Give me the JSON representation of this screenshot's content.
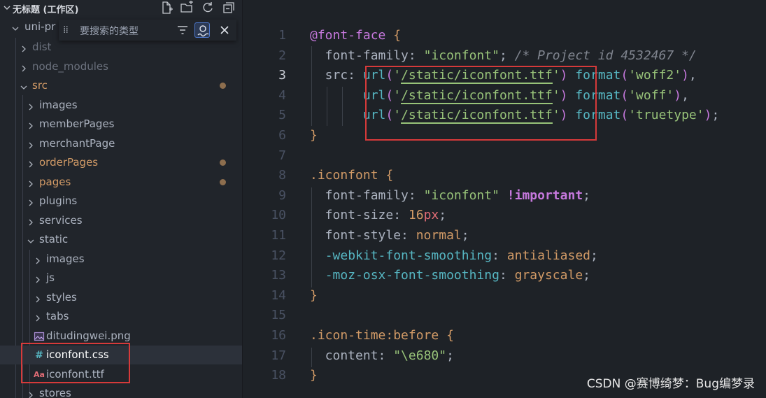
{
  "explorer": {
    "workspace_title": "无标题 (工作区)",
    "root_folder": "uni-pr",
    "search_placeholder": "要搜索的类型",
    "items": [
      {
        "label": "dist",
        "kind": "folder",
        "state": "ignored"
      },
      {
        "label": "node_modules",
        "kind": "folder",
        "state": "ignored"
      },
      {
        "label": "src",
        "kind": "folder",
        "state": "modified"
      },
      {
        "label": "images",
        "kind": "folder",
        "state": "normal"
      },
      {
        "label": "memberPages",
        "kind": "folder",
        "state": "normal"
      },
      {
        "label": "merchantPage",
        "kind": "folder",
        "state": "normal"
      },
      {
        "label": "orderPages",
        "kind": "folder",
        "state": "modified"
      },
      {
        "label": "pages",
        "kind": "folder",
        "state": "modified"
      },
      {
        "label": "plugins",
        "kind": "folder",
        "state": "normal"
      },
      {
        "label": "services",
        "kind": "folder",
        "state": "normal"
      },
      {
        "label": "static",
        "kind": "folder",
        "state": "normal"
      },
      {
        "label": "images",
        "kind": "folder",
        "state": "normal"
      },
      {
        "label": "js",
        "kind": "folder",
        "state": "normal"
      },
      {
        "label": "styles",
        "kind": "folder",
        "state": "normal"
      },
      {
        "label": "tabs",
        "kind": "folder",
        "state": "normal"
      },
      {
        "label": "ditudingwei.png",
        "kind": "file",
        "state": "normal"
      },
      {
        "label": "iconfont.css",
        "kind": "file",
        "state": "selected"
      },
      {
        "label": "iconfont.ttf",
        "kind": "file",
        "state": "normal"
      },
      {
        "label": "stores",
        "kind": "folder",
        "state": "normal"
      }
    ],
    "icons": {
      "css_file": "#",
      "ttf_file": "A",
      "png_file": "image-icon"
    }
  },
  "editor": {
    "current_line": 3,
    "line_numbers": [
      "1",
      "2",
      "3",
      "4",
      "5",
      "6",
      "7",
      "8",
      "9",
      "10",
      "11",
      "12",
      "13",
      "14",
      "15",
      "16",
      "17",
      "18"
    ],
    "lines": [
      "@font-face {",
      "  font-family: \"iconfont\"; /* Project id 4532467 */",
      "  src: url('/static/iconfont.ttf') format('woff2'),",
      "       url('/static/iconfont.ttf') format('woff'),",
      "       url('/static/iconfont.ttf') format('truetype');",
      "}",
      "",
      ".iconfont {",
      "  font-family: \"iconfont\" !important;",
      "  font-size: 16px;",
      "  font-style: normal;",
      "  -webkit-font-smoothing: antialiased;",
      "  -moz-osx-font-smoothing: grayscale;",
      "}",
      "",
      ".icon-time:before {",
      "  content: \"\\e680\";",
      "}"
    ]
  },
  "watermark": "CSDN @赛博绮梦：Bug编梦录",
  "colors": {
    "highlight_box": "#d63a3a",
    "string": "#98c379",
    "keyword": "#c678dd",
    "function": "#56b6c2",
    "number": "#d19a66"
  }
}
